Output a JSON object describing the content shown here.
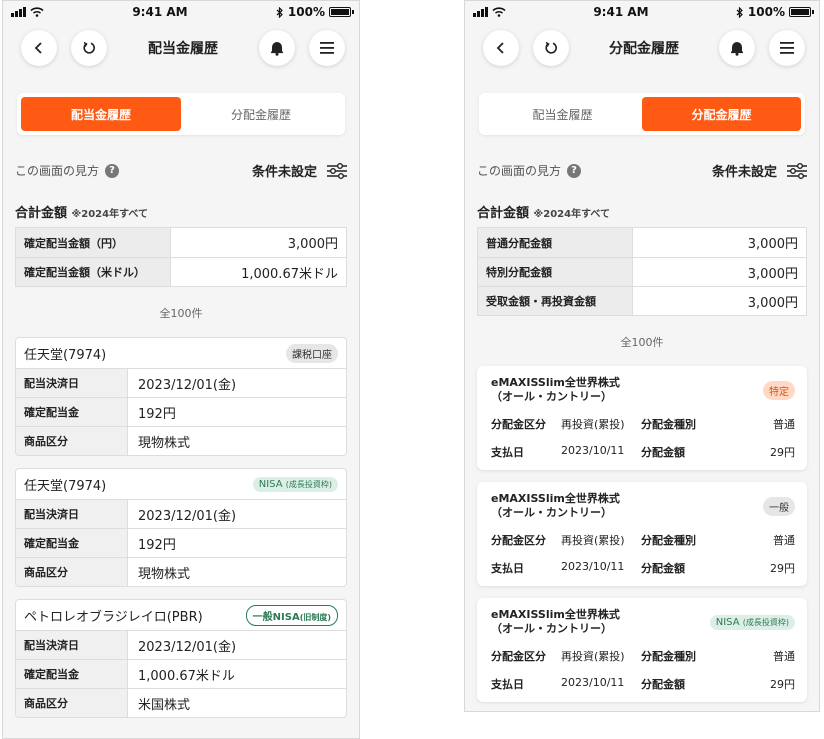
{
  "status": {
    "time": "9:41 AM",
    "battery": "100%"
  },
  "left": {
    "title": "配当金履歴",
    "tabs": [
      {
        "label": "配当金履歴",
        "active": true
      },
      {
        "label": "分配金履歴",
        "active": false
      }
    ],
    "howto": "この画面の見方",
    "filter": "条件未設定",
    "total_title": "合計金額",
    "total_note": "※2024年すべて",
    "summary": [
      {
        "label": "確定配当金額（円）",
        "value": "3,000円"
      },
      {
        "label": "確定配当金額（米ドル）",
        "value": "1,000.67米ドル"
      }
    ],
    "count": "全100件",
    "cards": [
      {
        "name": "任天堂(7974)",
        "badge": "課税口座",
        "badge_style": "gray",
        "rows": [
          {
            "label": "配当決済日",
            "value": "2023/12/01(金)"
          },
          {
            "label": "確定配当金",
            "value": "192円"
          },
          {
            "label": "商品区分",
            "value": "現物株式"
          }
        ]
      },
      {
        "name": "任天堂(7974)",
        "badge": "NISA",
        "badge_sub": "(成長投資枠)",
        "badge_style": "green",
        "rows": [
          {
            "label": "配当決済日",
            "value": "2023/12/01(金)"
          },
          {
            "label": "確定配当金",
            "value": "192円"
          },
          {
            "label": "商品区分",
            "value": "現物株式"
          }
        ]
      },
      {
        "name": "ペトロレオブラジレイロ(PBR)",
        "badge": "一般NISA",
        "badge_sub": "(旧制度)",
        "badge_style": "outline",
        "rows": [
          {
            "label": "配当決済日",
            "value": "2023/12/01(金)"
          },
          {
            "label": "確定配当金",
            "value": "1,000.67米ドル"
          },
          {
            "label": "商品区分",
            "value": "米国株式"
          }
        ]
      }
    ]
  },
  "right": {
    "title": "分配金履歴",
    "tabs": [
      {
        "label": "配当金履歴",
        "active": false
      },
      {
        "label": "分配金履歴",
        "active": true
      }
    ],
    "howto": "この画面の見方",
    "filter": "条件未設定",
    "total_title": "合計金額",
    "total_note": "※2024年すべて",
    "summary": [
      {
        "label": "普通分配金額",
        "value": "3,000円"
      },
      {
        "label": "特別分配金額",
        "value": "3,000円"
      },
      {
        "label": "受取金額・再投資金額",
        "value": "3,000円"
      }
    ],
    "count": "全100件",
    "funds": [
      {
        "name1": "eMAXISSlim全世界株式",
        "name2": "（オール・カントリー）",
        "badge": "特定",
        "badge_sub": "",
        "badge_style": "orange",
        "k1": "分配金区分",
        "v1": "再投資(累投)",
        "k2": "分配金種別",
        "v2": "普通",
        "k3": "支払日",
        "v3": "2023/10/11",
        "k4": "分配金額",
        "v4": "29円"
      },
      {
        "name1": "eMAXISSlim全世界株式",
        "name2": "（オール・カントリー）",
        "badge": "一般",
        "badge_sub": "",
        "badge_style": "gray",
        "k1": "分配金区分",
        "v1": "再投資(累投)",
        "k2": "分配金種別",
        "v2": "普通",
        "k3": "支払日",
        "v3": "2023/10/11",
        "k4": "分配金額",
        "v4": "29円"
      },
      {
        "name1": "eMAXISSlim全世界株式",
        "name2": "（オール・カントリー）",
        "badge": "NISA",
        "badge_sub": "(成長投資枠)",
        "badge_style": "green",
        "k1": "分配金区分",
        "v1": "再投資(累投)",
        "k2": "分配金種別",
        "v2": "普通",
        "k3": "支払日",
        "v3": "2023/10/11",
        "k4": "分配金額",
        "v4": "29円"
      }
    ]
  }
}
